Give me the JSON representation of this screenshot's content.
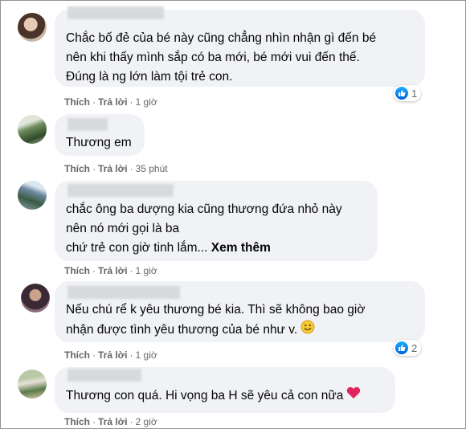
{
  "comments": [
    {
      "lines": [
        "Chắc bố đẻ của bé này cũng chẳng nhìn nhận gì đến bé",
        "nên khi thấy mình sắp có ba mới, bé mới vui đến thế.",
        "Đúng là ng lớn làm tội trẻ con."
      ],
      "like": "Thích",
      "reply": "Trả lời",
      "time": "1 giờ",
      "reaction_count": "1"
    },
    {
      "lines": [
        "Thương em"
      ],
      "like": "Thích",
      "reply": "Trả lời",
      "time": "35 phút"
    },
    {
      "lines": [
        "chắc ông ba dượng kia cũng thương đứa nhỏ này",
        "nên nó mới gọi là ba",
        "chứ trẻ con giờ tinh lắm..."
      ],
      "see_more": "Xem thêm",
      "like": "Thích",
      "reply": "Trả lời",
      "time": "1 giờ"
    },
    {
      "lines": [
        "Nếu chú rể k yêu thương bé kia. Thì sẽ không bao giờ",
        "nhận được tình yêu thương của bé như v."
      ],
      "like": "Thích",
      "reply": "Trả lời",
      "time": "1 giờ",
      "reaction_count": "2"
    },
    {
      "lines": [
        "Thương con quá. Hi vọng ba H sẽ yêu cả con nữa"
      ],
      "like": "Thích",
      "reply": "Trả lời",
      "time": "2 giờ"
    }
  ],
  "icons": {
    "like": "like-icon",
    "smile": "smile-emoji-icon",
    "heart": "heart-emoji-icon"
  },
  "colors": {
    "bubble": "#f0f2f5",
    "like_blue": "#1877f2",
    "meta_text": "#65676b"
  }
}
